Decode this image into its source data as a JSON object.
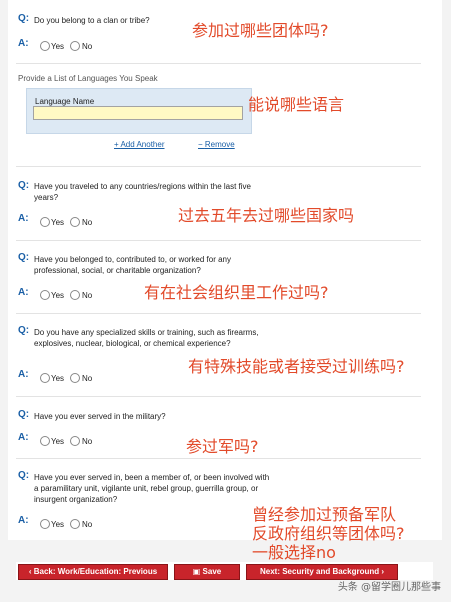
{
  "colors": {
    "accent": "#1a5fa6",
    "annotation": "#e24a2a",
    "button": "#c8242b",
    "input_highlight": "#fff9c4"
  },
  "labels": {
    "q": "Q:",
    "a": "A:"
  },
  "options": {
    "yes": "Yes",
    "no": "No"
  },
  "questions": {
    "clan": "Do you belong to a clan or tribe?",
    "travel": "Have you traveled to any countries/regions within the last five years?",
    "organization": "Have you belonged to, contributed to, or worked for any professional, social, or charitable organization?",
    "skills": "Do you have any specialized skills or training, such as firearms, explosives, nuclear, biological, or chemical experience?",
    "military": "Have you ever served in the military?",
    "paramilitary": "Have you ever served in, been a member of, or been involved with a paramilitary unit, vigilante unit, rebel group, guerrilla group, or insurgent organization?"
  },
  "languages": {
    "heading": "Provide a List of Languages You Speak",
    "field_label": "Language Name",
    "field_value": "",
    "add_another": "Add Another",
    "remove": "Remove"
  },
  "annotations": {
    "clan": "参加过哪些团体吗?",
    "languages": "能说哪些语言",
    "travel": "过去五年去过哪些国家吗",
    "organization": "有在社会组织里工作过吗?",
    "skills": "有特殊技能或者接受过训练吗?",
    "military": "参过军吗?",
    "paramilitary_1": "曾经参加过预备军队",
    "paramilitary_2": "反政府组织等团体吗?",
    "paramilitary_3": "一般选择no"
  },
  "footer": {
    "back": "Back: Work/Education: Previous",
    "save": "Save",
    "next": "Next: Security and Background"
  },
  "watermark": "头条 @留学圈儿那些事"
}
